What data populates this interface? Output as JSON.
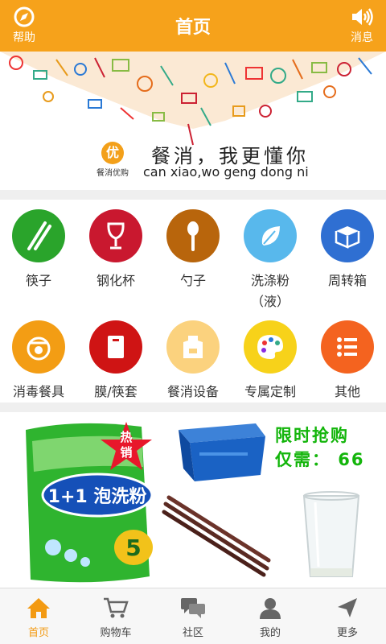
{
  "colors": {
    "primary": "#f6a21b",
    "tab_active": "#f39a12",
    "promo_green": "#13b50b"
  },
  "header": {
    "title": "首页",
    "left_button": {
      "label": "帮助",
      "icon": "compass-icon"
    },
    "right_button": {
      "label": "消息",
      "icon": "speaker-icon"
    }
  },
  "banner": {
    "logo_char": "优",
    "logo_name": "餐消优购",
    "slogan_cn": "餐消，我更懂你",
    "slogan_pinyin": "can xiao,wo geng dong ni"
  },
  "categories": [
    {
      "label": "筷子",
      "icon": "chopsticks-icon",
      "color": "#2aa42b"
    },
    {
      "label": "钢化杯",
      "icon": "wine-glass-icon",
      "color": "#c9182f"
    },
    {
      "label": "勺子",
      "icon": "spoon-icon",
      "color": "#b8650c"
    },
    {
      "label": "洗涤粉",
      "label_line2": "（液）",
      "icon": "leaf-icon",
      "color": "#58b8ec"
    },
    {
      "label": "周转箱",
      "icon": "box-icon",
      "color": "#2f6fd2"
    },
    {
      "label": "消毒餐具",
      "icon": "dish-icon",
      "color": "#f39d14"
    },
    {
      "label": "膜/筷套",
      "icon": "bag-icon",
      "color": "#cf1414"
    },
    {
      "label": "餐消设备",
      "icon": "apron-icon",
      "color": "#fbd27e"
    },
    {
      "label": "专属定制",
      "icon": "palette-icon",
      "color": "#f7d21a"
    },
    {
      "label": "其他",
      "icon": "list-icon",
      "color": "#f4631f"
    }
  ],
  "promo": {
    "hot_badge": "热销",
    "detergent_text": "1+1 泡洗粉",
    "detergent_number": "5",
    "flash_title": "限时抢购",
    "flash_price": "仅需： 66"
  },
  "tabs": [
    {
      "label": "首页",
      "icon": "home-icon",
      "active": true
    },
    {
      "label": "购物车",
      "icon": "cart-icon",
      "active": false
    },
    {
      "label": "社区",
      "icon": "chat-icon",
      "active": false
    },
    {
      "label": "我的",
      "icon": "user-icon",
      "active": false
    },
    {
      "label": "更多",
      "icon": "send-icon",
      "active": false
    }
  ]
}
